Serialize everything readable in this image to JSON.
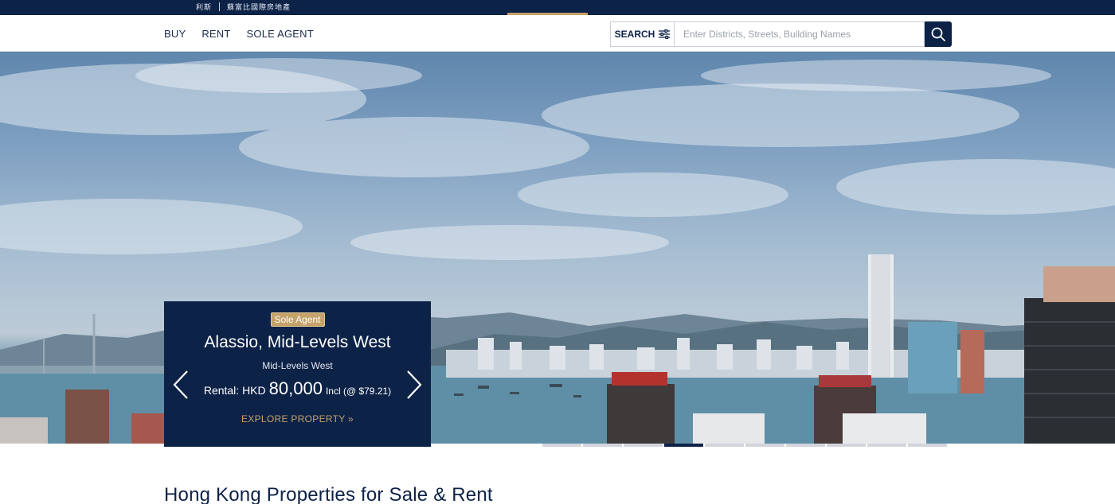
{
  "brand": {
    "en": "利斯",
    "zh": "蘇富比國際房地產"
  },
  "nav": {
    "items": [
      "BUY",
      "RENT",
      "SOLE AGENT"
    ]
  },
  "search": {
    "label": "SEARCH",
    "placeholder": "Enter Districts, Streets, Building Names"
  },
  "hero": {
    "carousel": {
      "slide_count": 10,
      "active_index": 3
    }
  },
  "card": {
    "badge": "Sole Agent",
    "title": "Alassio, Mid-Levels West",
    "subtitle": "Mid-Levels West",
    "price_prefix": "Rental: HKD",
    "price_amount": "80,000",
    "price_suffix": "Incl (@ $79.21)",
    "cta": "EXPLORE PROPERTY »"
  },
  "section": {
    "title": "Hong Kong Properties for Sale & Rent"
  },
  "colors": {
    "navy": "#0d2247",
    "gold": "#c5a269"
  },
  "icons": [
    "filter-sliders-icon",
    "search-icon",
    "chevron-left-icon",
    "chevron-right-icon"
  ]
}
